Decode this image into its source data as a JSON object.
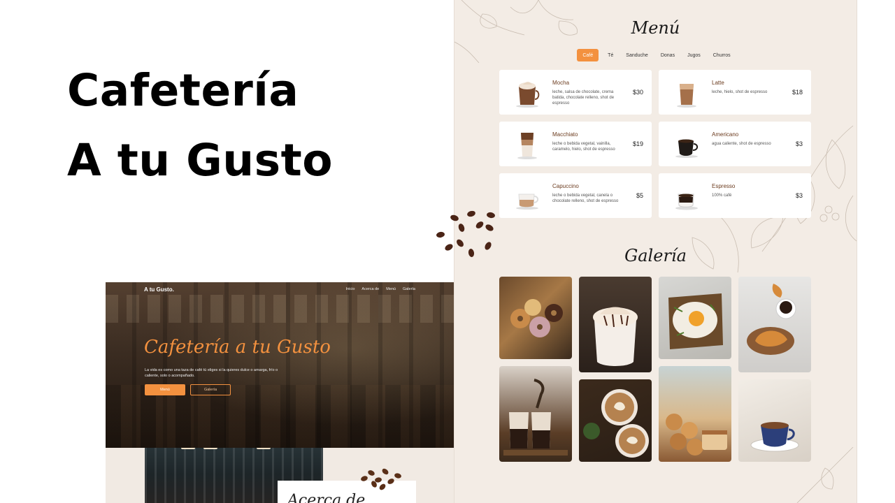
{
  "headline": {
    "line1": "Cafetería",
    "line2": "A tu Gusto"
  },
  "hero": {
    "logo": "A tu Gusto.",
    "nav": [
      "Inicio",
      "Acerca de",
      "Menú",
      "Galería"
    ],
    "title": "Cafetería a tu Gusto",
    "subtitle": "La vida es como una taza de café tú eliges si la quieres dulce o amarga, frío o caliente, solo o acompañado.",
    "btn_primary": "Menú",
    "btn_secondary": "Galería",
    "about_title": "Acerca de"
  },
  "menu": {
    "title": "Menú",
    "tabs": [
      "Café",
      "Té",
      "Sanduche",
      "Donas",
      "Jugos",
      "Churros"
    ],
    "active_tab": "Café",
    "items": [
      {
        "name": "Mocha",
        "desc": "leche, salsa de chocolate, crema batida, chocolate relleno, shot de espresso",
        "price": "$30"
      },
      {
        "name": "Latte",
        "desc": "leche, hielo, shot de espresso",
        "price": "$18"
      },
      {
        "name": "Macchiato",
        "desc": "leche o bebida vegetal, vainilla, caramelo, hielo, shot de espresso",
        "price": "$19"
      },
      {
        "name": "Americano",
        "desc": "agua caliente, shot de espresso",
        "price": "$3"
      },
      {
        "name": "Capuccino",
        "desc": "leche o bebida vegetal, canela o chocolate relleno, shot de espresso",
        "price": "$5"
      },
      {
        "name": "Espresso",
        "desc": "100% café",
        "price": "$3"
      }
    ]
  },
  "gallery": {
    "title": "Galería"
  },
  "colors": {
    "accent": "#f3913f",
    "panel_bg": "#f3ece5",
    "item_name": "#6b3b1e"
  }
}
